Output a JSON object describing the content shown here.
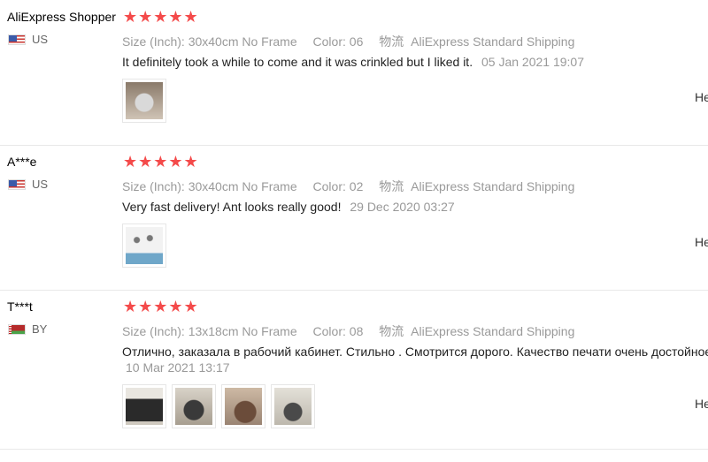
{
  "side_text": "He",
  "labels": {
    "size": "Size (Inch):",
    "color": "Color:",
    "shipping_icon": "物流"
  },
  "colors": {
    "star": "#f44a4a",
    "muted": "#999999"
  },
  "reviews": [
    {
      "buyer": "AliExpress Shopper",
      "country": "US",
      "flag": "us",
      "stars": "★★★★★",
      "size": "30x40cm No Frame",
      "color": "06",
      "shipping": "AliExpress Standard Shipping",
      "text": "It definitely took a while to come and it was crinkled but I liked it.",
      "date": "05 Jan 2021 19:07",
      "images": [
        "img-a"
      ]
    },
    {
      "buyer": "A***e",
      "country": "US",
      "flag": "us",
      "stars": "★★★★★",
      "size": "30x40cm No Frame",
      "color": "02",
      "shipping": "AliExpress Standard Shipping",
      "text": "Very fast delivery! Ant looks really good!",
      "date": "29 Dec 2020 03:27",
      "images": [
        "img-b"
      ]
    },
    {
      "buyer": "T***t",
      "country": "BY",
      "flag": "by",
      "stars": "★★★★★",
      "size": "13x18cm No Frame",
      "color": "08",
      "shipping": "AliExpress Standard Shipping",
      "text": "Отлично, заказала в рабочий кабинет. Стильно . Смотрится дорого. Качество печати очень достойное",
      "date": "10 Mar 2021 13:17",
      "images": [
        "img-c",
        "img-d",
        "img-e",
        "img-f"
      ]
    }
  ]
}
